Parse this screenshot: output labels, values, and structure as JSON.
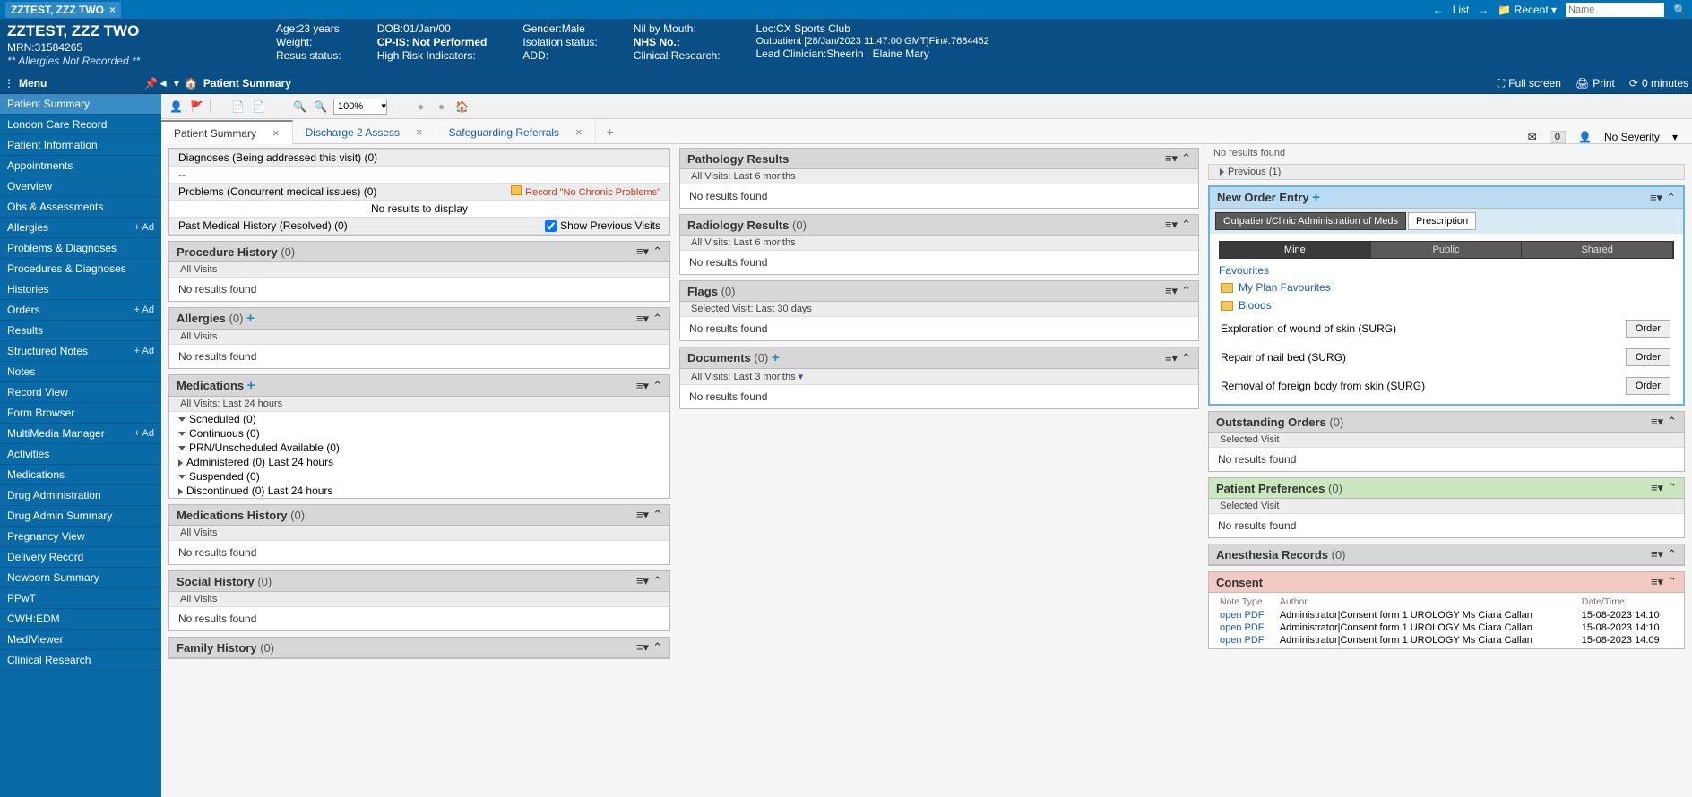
{
  "titlebar": {
    "tab_name": "ZZTEST, ZZZ TWO",
    "list": "List",
    "recent": "Recent",
    "search_placeholder": "Name"
  },
  "patient": {
    "name": "ZZTEST, ZZZ TWO",
    "mrn": "MRN:31584265",
    "allergies": "** Allergies Not Recorded **",
    "age": "Age:23 years",
    "weight": "Weight:",
    "resus": "Resus status:",
    "dob": "DOB:01/Jan/00",
    "cpis": "CP-IS: Not Performed",
    "risk": "High Risk Indicators:",
    "gender": "Gender:Male",
    "iso": "Isolation status:",
    "add": "ADD:",
    "nil": "Nil by Mouth:",
    "nhs": "NHS No.:",
    "research": "Clinical Research:",
    "loc": "Loc:CX Sports Club",
    "outp": "Outpatient [28/Jan/2023 11:47:00 GMT]Fin#:7684452",
    "lead": "Lead Clinician:Sheerin , Elaine Mary"
  },
  "menubar": {
    "menu": "Menu",
    "crumb": "Patient Summary",
    "full": "Full screen",
    "print": "Print",
    "refresh": "0 minutes"
  },
  "sidebar": [
    {
      "label": "Patient Summary",
      "active": true
    },
    {
      "label": "London Care Record"
    },
    {
      "label": "Patient Information"
    },
    {
      "label": "Appointments"
    },
    {
      "label": "Overview"
    },
    {
      "label": "Obs & Assessments"
    },
    {
      "label": "Allergies",
      "add": "+ Ad"
    },
    {
      "label": "Problems & Diagnoses"
    },
    {
      "label": "Procedures & Diagnoses"
    },
    {
      "label": "Histories"
    },
    {
      "label": "Orders",
      "add": "+ Ad"
    },
    {
      "label": "Results"
    },
    {
      "label": "Structured Notes",
      "add": "+ Ad"
    },
    {
      "label": "Notes"
    },
    {
      "label": "Record View"
    },
    {
      "label": "Form Browser"
    },
    {
      "label": "MultiMedia Manager",
      "add": "+ Ad"
    },
    {
      "label": "Activities"
    },
    {
      "label": "Medications"
    },
    {
      "label": "Drug Administration"
    },
    {
      "label": "Drug Admin Summary"
    },
    {
      "label": "Pregnancy View"
    },
    {
      "label": "Delivery Record"
    },
    {
      "label": "Newborn Summary"
    },
    {
      "label": "PPwT"
    },
    {
      "label": "CWH:EDM"
    },
    {
      "label": "MediViewer"
    },
    {
      "label": "Clinical Research"
    }
  ],
  "toolbar2": {
    "zoom": "100%"
  },
  "tabs": [
    {
      "label": "Patient Summary",
      "active": true
    },
    {
      "label": "Discharge 2 Assess"
    },
    {
      "label": "Safeguarding Referrals"
    }
  ],
  "tabs_right": {
    "badge": "0",
    "severity": "No Severity"
  },
  "col1": {
    "diag": {
      "title": "Diagnoses (Being addressed this visit)",
      "cnt": "(0)",
      "dash": "--"
    },
    "problems": {
      "title": "Problems (Concurrent medical issues)",
      "cnt": "(0)",
      "rec": "Record \"No Chronic Problems\"",
      "no_results": "No results to display"
    },
    "pmh": {
      "title": "Past Medical History (Resolved)",
      "cnt": "(0)",
      "show_prev": "Show Previous Visits"
    },
    "proc": {
      "title": "Procedure History",
      "cnt": "(0)",
      "sub": "All Visits",
      "body": "No results found"
    },
    "allg": {
      "title": "Allergies",
      "cnt": "(0)",
      "sub": "All Visits",
      "body": "No results found"
    },
    "meds": {
      "title": "Medications",
      "sub": "All Visits: Last 24 hours",
      "rows": [
        "Scheduled (0)",
        "Continuous (0)",
        "PRN/Unscheduled Available (0)",
        "Administered (0) Last 24 hours",
        "Suspended (0)",
        "Discontinued (0) Last 24 hours"
      ]
    },
    "medhist": {
      "title": "Medications History",
      "cnt": "(0)",
      "sub": "All Visits",
      "body": "No results found"
    },
    "social": {
      "title": "Social History",
      "cnt": "(0)",
      "sub": "All Visits",
      "body": "No results found"
    },
    "family": {
      "title": "Family History",
      "cnt": "(0)"
    }
  },
  "col2": {
    "path": {
      "title": "Pathology Results",
      "sub": "All Visits: Last 6 months",
      "body": "No results found"
    },
    "rad": {
      "title": "Radiology Results",
      "cnt": "(0)",
      "sub": "All Visits: Last 6 months",
      "body": "No results found"
    },
    "flags": {
      "title": "Flags",
      "cnt": "(0)",
      "sub": "Selected Visit: Last 30 days",
      "body": "No results found"
    },
    "docs": {
      "title": "Documents",
      "cnt": "(0)",
      "sub": "All Visits: Last 3 months",
      "body": "No results found"
    }
  },
  "col3": {
    "topnote": "No results found",
    "prev": "Previous (1)",
    "noe": {
      "title": "New Order Entry",
      "subtabs": [
        "Outpatient/Clinic Administration of Meds",
        "Prescription"
      ],
      "pilltabs": [
        "Mine",
        "Public",
        "Shared"
      ],
      "fav_title": "Favourites",
      "fav_items": [
        "My Plan Favourites",
        "Bloods"
      ],
      "orders": [
        "Exploration of wound of skin (SURG)",
        "Repair of nail bed (SURG)",
        "Removal of foreign body from skin (SURG)"
      ],
      "order_btn": "Order"
    },
    "out": {
      "title": "Outstanding Orders",
      "cnt": "(0)",
      "sub": "Selected Visit",
      "body": "No results found"
    },
    "pref": {
      "title": "Patient Preferences",
      "cnt": "(0)",
      "sub": "Selected Visit",
      "body": "No results found"
    },
    "anesth": {
      "title": "Anesthesia Records",
      "cnt": "(0)"
    },
    "consent": {
      "title": "Consent",
      "headers": [
        "Note Type",
        "Author",
        "Date/Time"
      ],
      "rows": [
        {
          "link": "open PDF",
          "auth": "Administrator|Consent form 1 UROLOGY Ms Ciara Callan",
          "dt": "15-08-2023 14:10"
        },
        {
          "link": "open PDF",
          "auth": "Administrator|Consent form 1 UROLOGY Ms Ciara Callan",
          "dt": "15-08-2023 14:10"
        },
        {
          "link": "open PDF",
          "auth": "Administrator|Consent form 1 UROLOGY Ms Ciara Callan",
          "dt": "15-08-2023 14:09"
        }
      ]
    }
  }
}
